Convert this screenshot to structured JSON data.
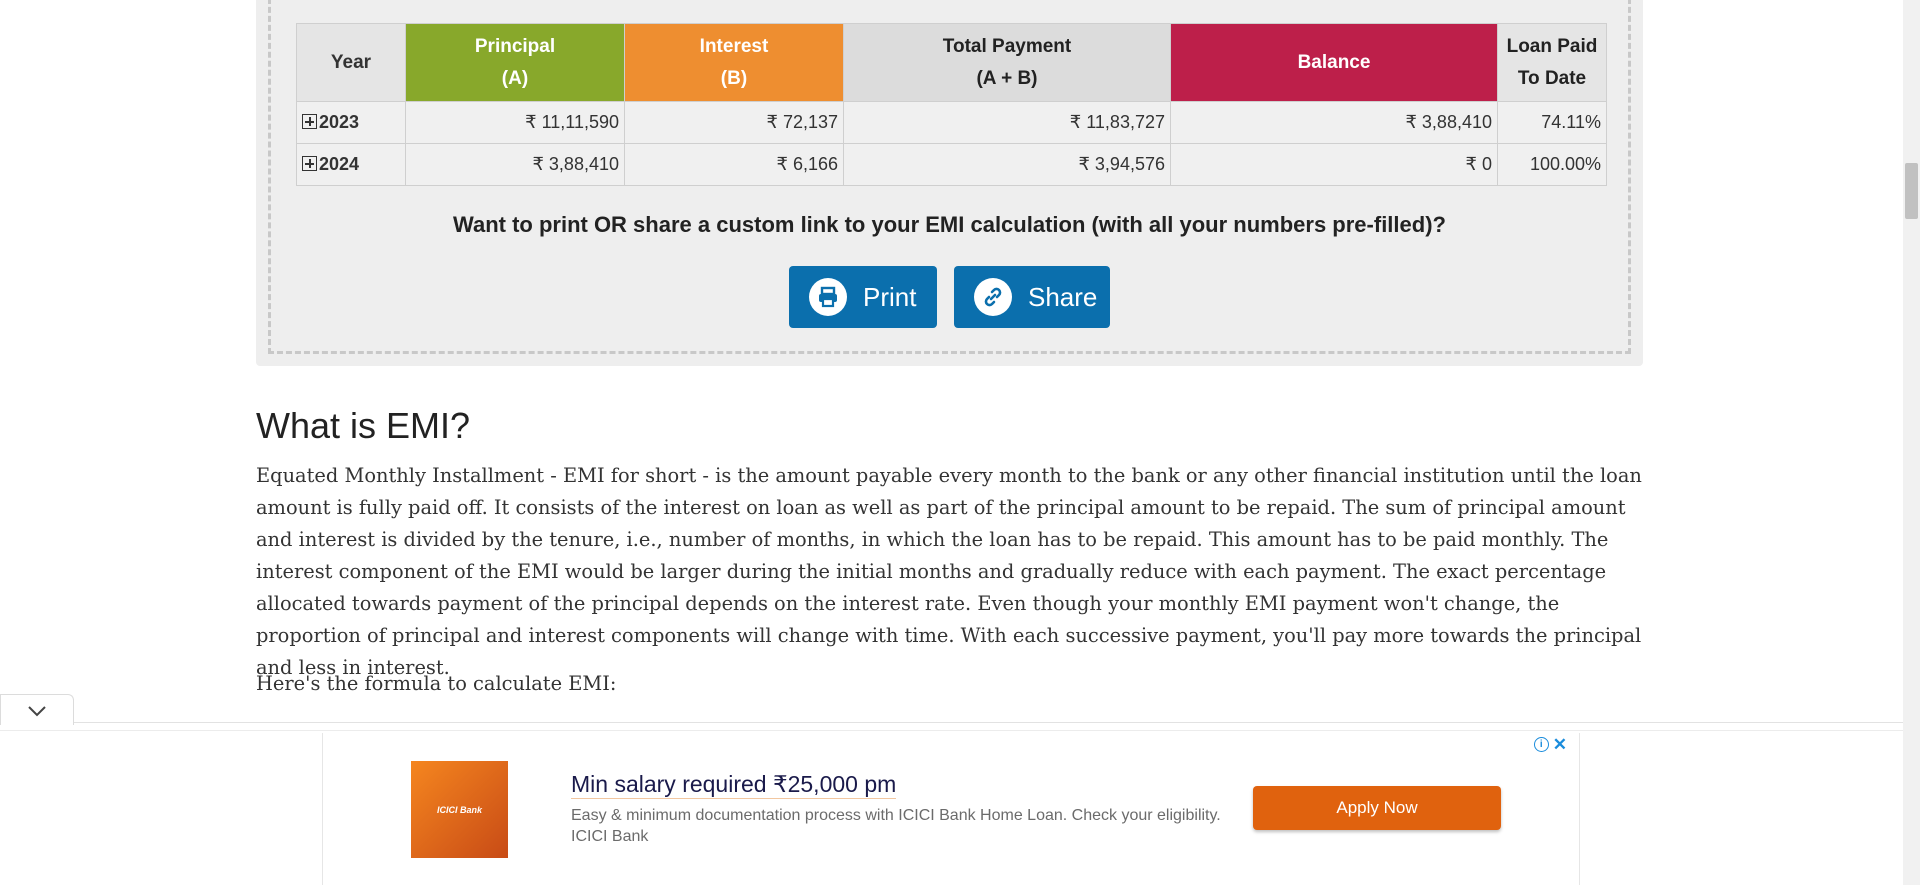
{
  "schedule": {
    "headers": {
      "year": "Year",
      "principal": "Principal",
      "principal_sub": "(A)",
      "interest": "Interest",
      "interest_sub": "(B)",
      "total": "Total Payment",
      "total_sub": "(A + B)",
      "balance": "Balance",
      "paid": "Loan Paid",
      "paid_sub": "To Date"
    },
    "rows": [
      {
        "year": "2023",
        "principal": "₹ 11,11,590",
        "interest": "₹ 72,137",
        "total": "₹ 11,83,727",
        "balance": "₹ 3,88,410",
        "paid": "74.11%"
      },
      {
        "year": "2024",
        "principal": "₹ 3,88,410",
        "interest": "₹ 6,166",
        "total": "₹ 3,94,576",
        "balance": "₹ 0",
        "paid": "100.00%"
      }
    ],
    "colors": {
      "principal": "#88a82b",
      "interest": "#ee8e30",
      "balance": "#bd1f4a",
      "button": "#0b6fad"
    }
  },
  "share": {
    "question": "Want to print OR share a custom link to your EMI calculation (with all your numbers pre-filled)?",
    "print_label": "Print",
    "share_label": "Share"
  },
  "article": {
    "title": "What is EMI?",
    "body": "Equated Monthly Installment - EMI for short - is the amount payable every month to the bank or any other financial institution until the loan amount is fully paid off. It consists of the interest on loan as well as part of the principal amount to be repaid. The sum of principal amount and interest is divided by the tenure, i.e., number of months, in which the loan has to be repaid. This amount has to be paid monthly. The interest component of the EMI would be larger during the initial months and gradually reduce with each payment. The exact percentage allocated towards payment of the principal depends on the interest rate. Even though your monthly EMI payment won't change, the proportion of principal and interest components will change with time. With each successive payment, you'll pay more towards the principal and less in interest.",
    "formula_intro": "Here's the formula to calculate EMI:"
  },
  "ad": {
    "logo_text": "ICICI Bank",
    "headline": "Min salary required ₹25,000 pm",
    "description": "Easy & minimum documentation process with ICICI Bank Home Loan. Check your eligibility. ICICI Bank",
    "cta": "Apply Now",
    "accent": "#e0620e"
  }
}
